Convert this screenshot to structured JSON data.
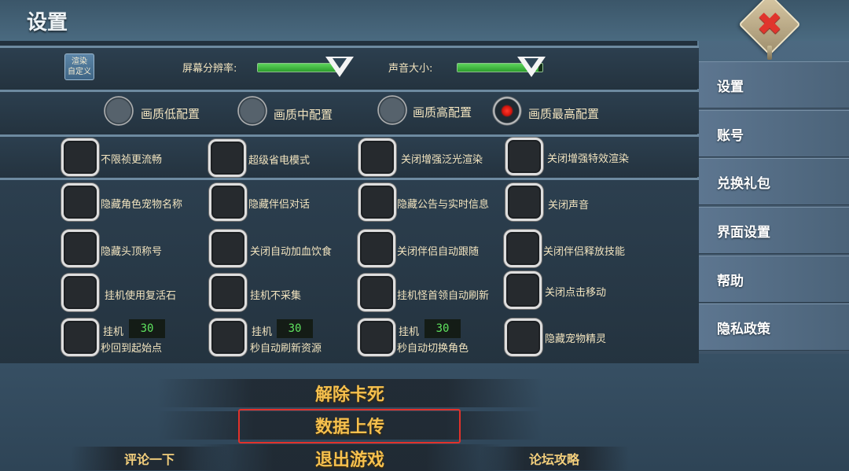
{
  "header": {
    "title": "设置"
  },
  "display": {
    "render_button": "渲染自定义",
    "resolution_label": "屏幕分辨率:",
    "resolution_level": 0.95,
    "volume_label": "声音大小:",
    "volume_level": 0.95
  },
  "quality": {
    "options": [
      "画质低配置",
      "画质中配置",
      "画质高配置",
      "画质最高配置"
    ],
    "selected": "画质最高配置"
  },
  "options": {
    "row1": [
      "不限祯更流畅",
      "超级省电模式",
      "关闭增强泛光渲染",
      "关闭增强特效渲染"
    ],
    "row2": [
      "隐藏角色宠物名称",
      "隐藏伴侣对话",
      "隐藏公告与实时信息",
      "关闭声音"
    ],
    "row3": [
      "隐藏头顶称号",
      "关闭自动加血饮食",
      "关闭伴侣自动跟随",
      "关闭伴侣释放技能"
    ],
    "row4": [
      "挂机使用复活石",
      "挂机不采集",
      "挂机怪首领自动刷新",
      "关闭点击移动"
    ],
    "row5": [
      {
        "prefix": "挂机",
        "value": "30",
        "suffix": "秒回到起始点"
      },
      {
        "prefix": "挂机",
        "value": "30",
        "suffix": "秒自动刷新资源"
      },
      {
        "prefix": "挂机",
        "value": "30",
        "suffix": "秒自动切换角色"
      },
      {
        "label": "隐藏宠物精灵"
      }
    ]
  },
  "sidebar": {
    "items": [
      "设置",
      "账号",
      "兑换礼包",
      "界面设置",
      "帮助",
      "隐私政策"
    ]
  },
  "bottom": {
    "unstuck": "解除卡死",
    "upload": "数据上传",
    "exit": "退出游戏",
    "review": "评论一下",
    "forum": "论坛攻略"
  },
  "colors": {
    "slider_fill": "#3cbf3a",
    "selected_radio": "#e2231a",
    "highlight_frame": "#e2312a",
    "bottom_text": "#f6c04d"
  }
}
